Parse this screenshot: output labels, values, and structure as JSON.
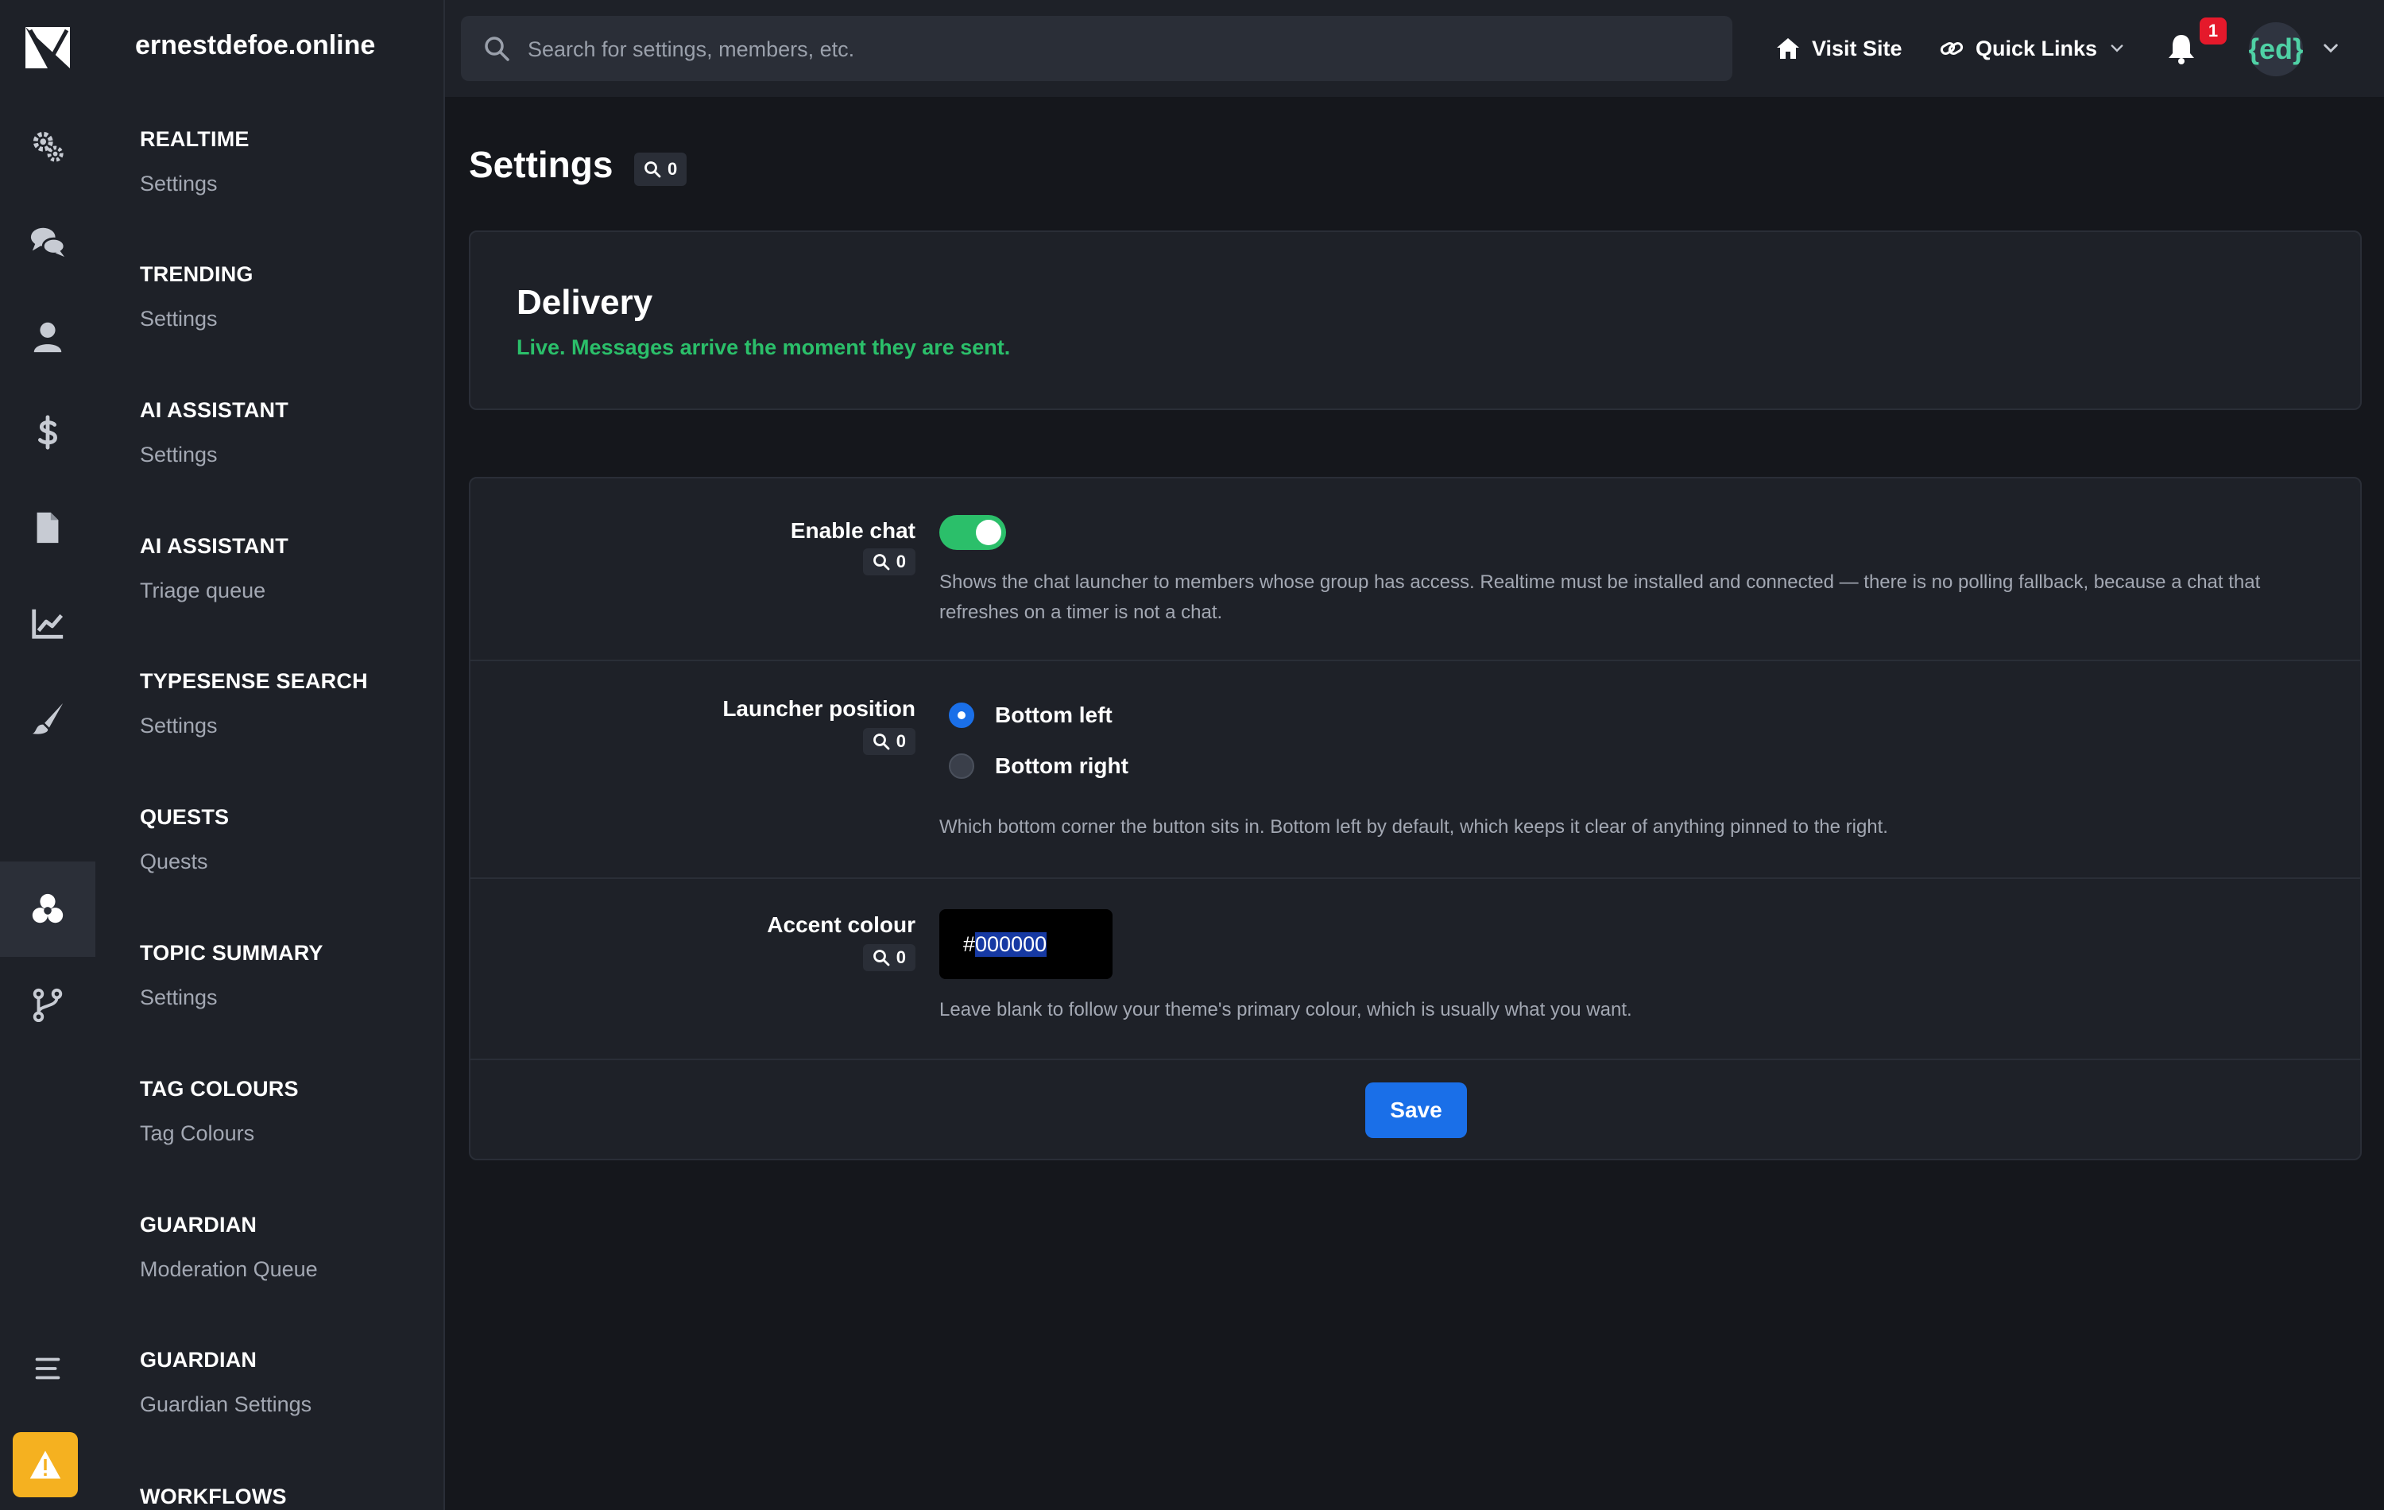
{
  "rail": {
    "icons": [
      "logo-icon",
      "settings-gears-icon",
      "chat-bubbles-icon",
      "user-icon",
      "dollar-icon",
      "document-icon",
      "chart-line-icon",
      "paintbrush-icon",
      "puzzle-icon",
      "workflow-branch-icon",
      "menu-icon",
      "warning-icon"
    ],
    "active": "puzzle-icon"
  },
  "sidebar": {
    "site_name": "ernestdefoe.online",
    "sections": [
      {
        "heading": "REALTIME",
        "item": "Settings"
      },
      {
        "heading": "TRENDING",
        "item": "Settings"
      },
      {
        "heading": "AI ASSISTANT",
        "item": "Settings"
      },
      {
        "heading": "AI ASSISTANT",
        "item": "Triage queue"
      },
      {
        "heading": "TYPESENSE SEARCH",
        "item": "Settings"
      },
      {
        "heading": "QUESTS",
        "item": "Quests"
      },
      {
        "heading": "TOPIC SUMMARY",
        "item": "Settings"
      },
      {
        "heading": "TAG COLOURS",
        "item": "Tag Colours"
      },
      {
        "heading": "GUARDIAN",
        "item": "Moderation Queue"
      },
      {
        "heading": "GUARDIAN",
        "item": "Guardian Settings"
      },
      {
        "heading": "WORKFLOWS",
        "item": ""
      }
    ]
  },
  "topbar": {
    "search_placeholder": "Search for settings, members, etc.",
    "visit_site": "Visit Site",
    "quick_links": "Quick Links",
    "notification_count": "1",
    "avatar_text": "{ed}"
  },
  "page": {
    "title": "Settings",
    "search_hits": "0"
  },
  "status": {
    "title": "Delivery",
    "subtitle": "Live. Messages arrive the moment they are sent.",
    "subtitle_color": "#2bbf6a"
  },
  "settings": {
    "enable_chat": {
      "label": "Enable chat",
      "hits": "0",
      "enabled": true,
      "help": "Shows the chat launcher to members whose group has access. Realtime must be installed and connected — there is no polling fallback, because a chat that refreshes on a timer is not a chat."
    },
    "launcher_position": {
      "label": "Launcher position",
      "hits": "0",
      "options": [
        "Bottom left",
        "Bottom right"
      ],
      "selected": "Bottom left",
      "help": "Which bottom corner the button sits in. Bottom left by default, which keeps it clear of anything pinned to the right."
    },
    "accent_colour": {
      "label": "Accent colour",
      "hits": "0",
      "prefix": "#",
      "value": "000000",
      "help": "Leave blank to follow your theme's primary colour, which is usually what you want."
    },
    "save_label": "Save"
  },
  "colors": {
    "accent_blue": "#1a6fe8",
    "toggle_on": "#2bbf6a",
    "badge_red": "#e5192b",
    "warning": "#f5b120"
  }
}
